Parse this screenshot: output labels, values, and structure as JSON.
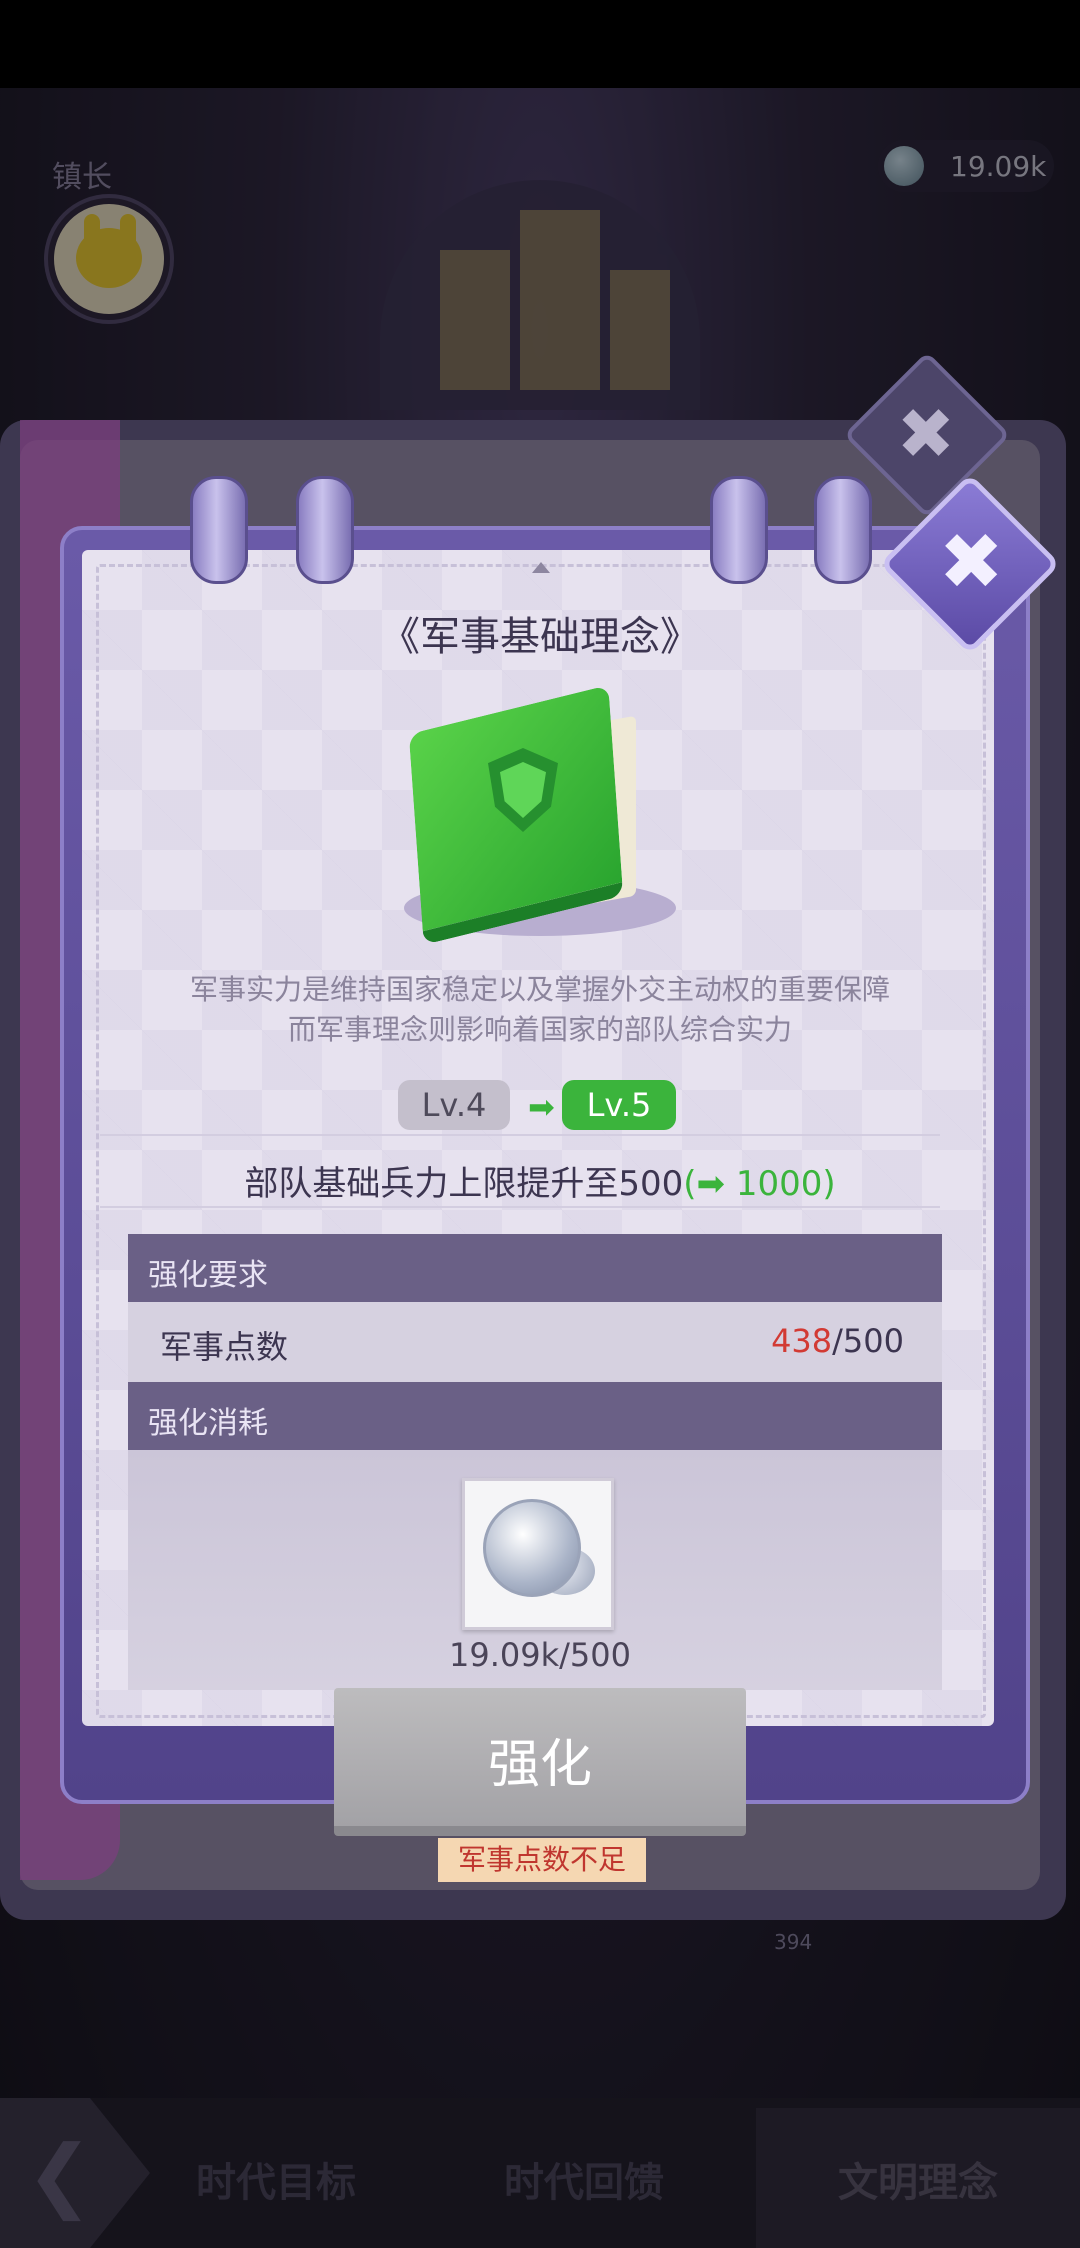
{
  "hud": {
    "role_label": "镇长",
    "currency_value": "19.09k"
  },
  "card": {
    "title": "《军事基础理念》",
    "description_line1": "军事实力是维持国家稳定以及掌握外交主动权的重要保障",
    "description_line2": "而军事理念则影响着国家的部队综合实力",
    "level_current": "Lv.4",
    "level_next": "Lv.5",
    "effect_text": "部队基础兵力上限提升至500",
    "effect_open": "(",
    "effect_arrow": "➡",
    "effect_new": "1000",
    "effect_close": ")",
    "requirement_header": "强化要求",
    "requirement_name": "军事点数",
    "requirement_current": "438",
    "requirement_total": "/500",
    "consume_header": "强化消耗",
    "consume_amount": "19.09k/500",
    "action_button": "强化",
    "warning": "军事点数不足",
    "close_symbol": "✖"
  },
  "background_book": {
    "page_number": "394"
  },
  "bottom_nav": {
    "back_symbol": "❮",
    "tabs": [
      "时代目标",
      "时代回馈",
      "文明理念"
    ],
    "active_tab": "文明理念"
  },
  "colors": {
    "accent_green": "#3bb43c",
    "warning_red": "#d23a34",
    "frame_purple": "#5b4aa5"
  },
  "icons": {
    "currency": "silver-coin-icon",
    "card_item": "green-shield-book-icon",
    "close": "close-icon"
  }
}
